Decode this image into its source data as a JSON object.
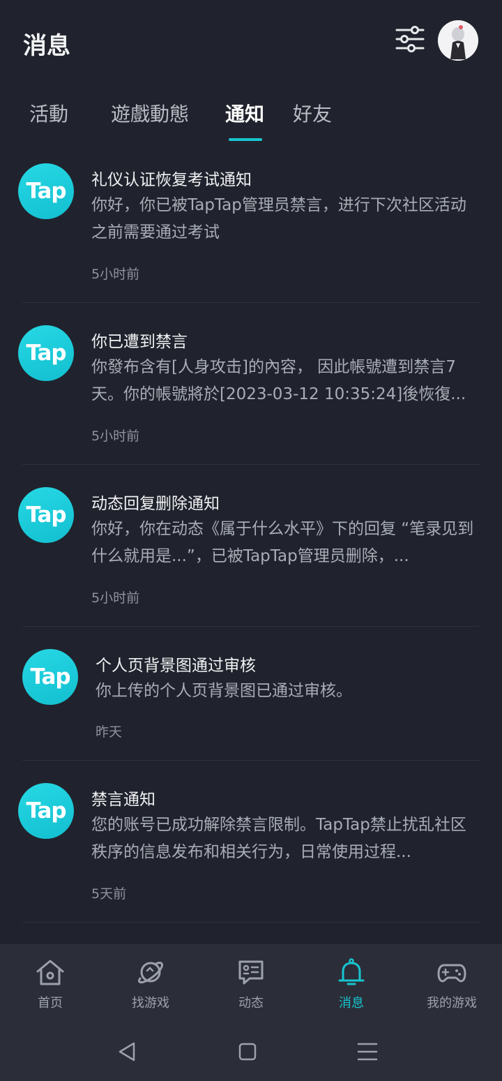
{
  "header": {
    "title": "消息",
    "filter_icon": "sliders-icon",
    "avatar_icon": "user-avatar"
  },
  "tabs": [
    {
      "label": "活動",
      "active": false
    },
    {
      "label": "遊戲動態",
      "active": false
    },
    {
      "label": "通知",
      "active": true
    },
    {
      "label": "好友",
      "active": false
    }
  ],
  "accent_color": "#17c5cf",
  "notifications": [
    {
      "logo_text": "Tap",
      "title": "礼仪认证恢复考试通知",
      "body": "你好，你已被TapTap管理员禁言，进行下次社区活动之前需要通过考试",
      "time": "5小时前"
    },
    {
      "logo_text": "Tap",
      "title": "你已遭到禁言",
      "body": "你發布含有[人身攻击]的內容， 因此帳號遭到禁言7 天。你的帳號將於[2023-03-12 10:35:24]後恢復...",
      "time": "5小时前"
    },
    {
      "logo_text": "Tap",
      "title": "动态回复删除通知",
      "body": "你好，你在动态《属于什么水平》下的回复 “笔录见到什么就用是...”，已被TapTap管理员删除，...",
      "time": "5小时前"
    },
    {
      "logo_text": "Tap",
      "title": "个人页背景图通过审核",
      "body": "你上传的个人页背景图已通过审核。",
      "time": "昨天"
    },
    {
      "logo_text": "Tap",
      "title": "禁言通知",
      "body": "您的账号已成功解除禁言限制。TapTap禁止扰乱社区秩序的信息发布和相关行为，日常使用过程...",
      "time": "5天前"
    }
  ],
  "bottom_nav": [
    {
      "label": "首页",
      "icon": "home-icon",
      "active": false
    },
    {
      "label": "找游戏",
      "icon": "planet-icon",
      "active": false
    },
    {
      "label": "动态",
      "icon": "chat-card-icon",
      "active": false
    },
    {
      "label": "消息",
      "icon": "bell-icon",
      "active": true
    },
    {
      "label": "我的游戏",
      "icon": "gamepad-icon",
      "active": false
    }
  ],
  "system_nav": {
    "back_icon": "back-triangle-icon",
    "home_icon": "home-square-icon",
    "recents_icon": "menu-lines-icon"
  }
}
